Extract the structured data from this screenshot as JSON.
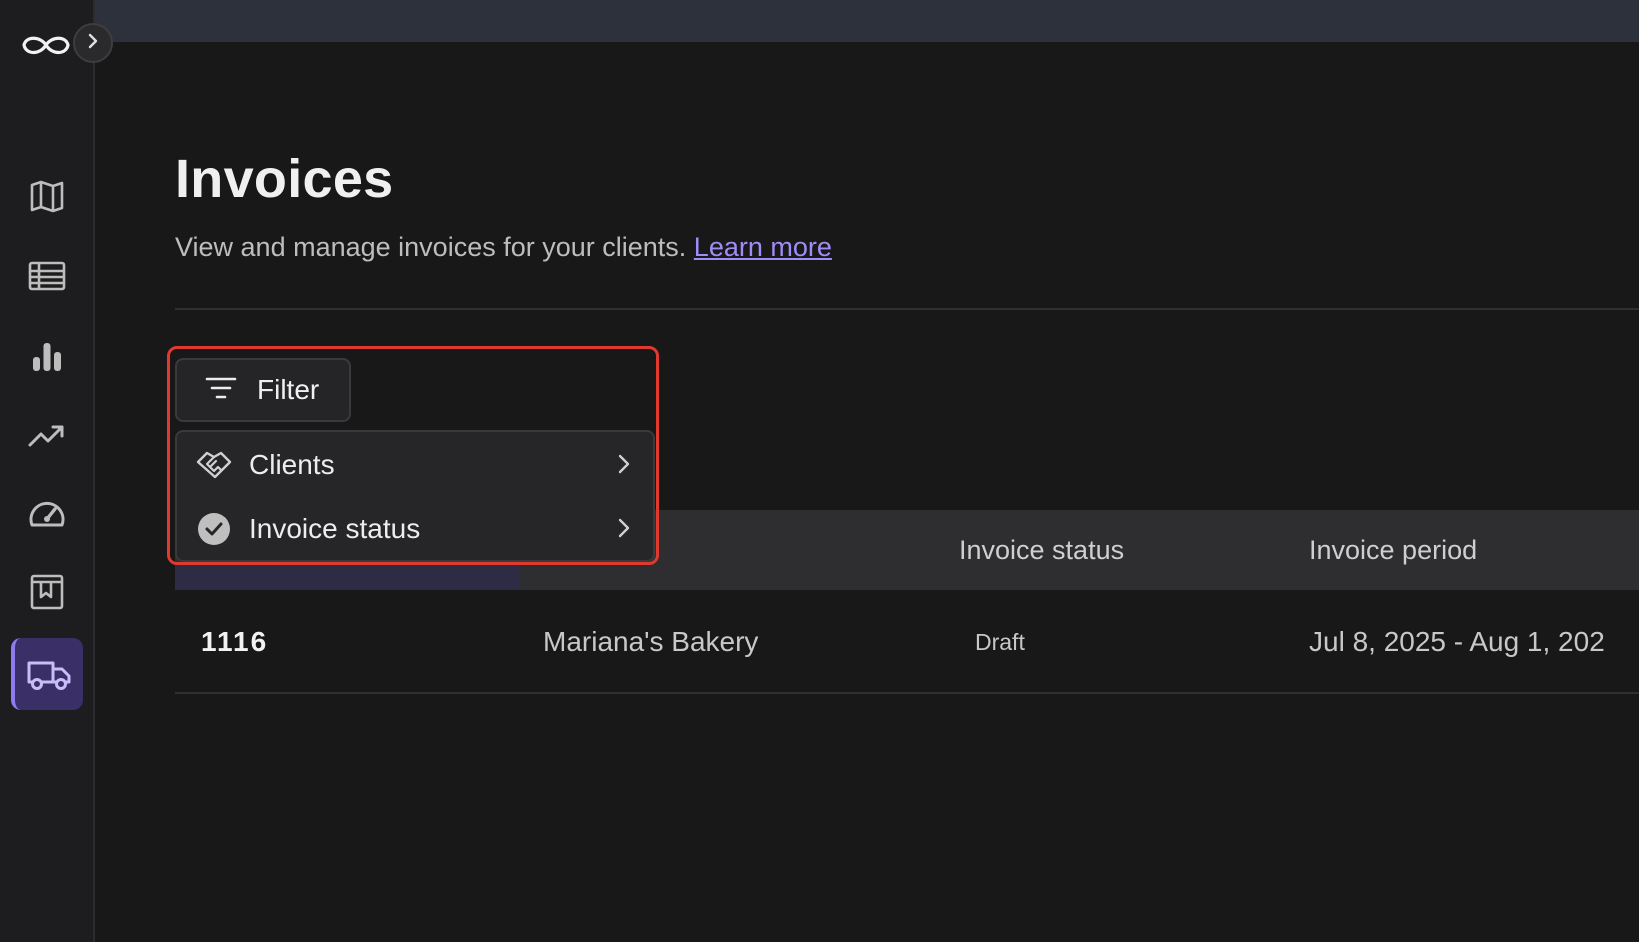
{
  "sidebar": {
    "logo_icon": "infinity-logo-icon",
    "collapse_icon": "chevron-right-icon",
    "items": [
      {
        "icon": "map-icon",
        "active": false
      },
      {
        "icon": "table-icon",
        "active": false
      },
      {
        "icon": "bar-chart-icon",
        "active": false
      },
      {
        "icon": "trend-line-icon",
        "active": false
      },
      {
        "icon": "gauge-icon",
        "active": false
      },
      {
        "icon": "bookmark-book-icon",
        "active": false
      },
      {
        "icon": "truck-icon",
        "active": true
      }
    ]
  },
  "page": {
    "title": "Invoices",
    "subtitle": "View and manage invoices for your clients.",
    "learn_more": "Learn more"
  },
  "filter": {
    "button_label": "Filter",
    "menu": [
      {
        "label": "Clients",
        "icon": "handshake-icon"
      },
      {
        "label": "Invoice status",
        "icon": "check-circle-icon"
      }
    ]
  },
  "table": {
    "columns": [
      "Invoice status",
      "Invoice period"
    ],
    "rows": [
      {
        "number": "1116",
        "client": "Mariana's Bakery",
        "status": "Draft",
        "period": "Jul 8, 2025 - Aug 1, 202"
      }
    ]
  },
  "colors": {
    "accent": "#8d7bf0",
    "link": "#a08cf5",
    "highlight": "#e03a2e",
    "background": "#181818"
  }
}
